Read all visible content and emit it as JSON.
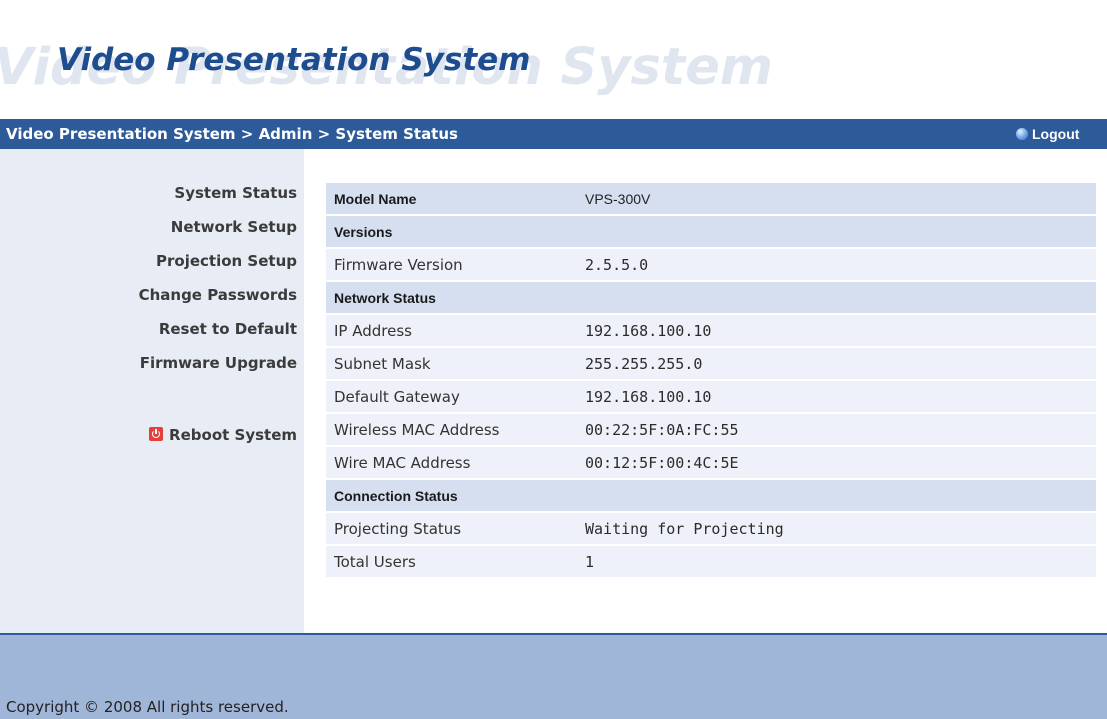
{
  "header": {
    "title": "Video Presentation System",
    "watermark": "Video Presentation System"
  },
  "navbar": {
    "breadcrumb": "Video Presentation System > Admin > System Status",
    "logout_label": "Logout"
  },
  "sidebar": {
    "items": [
      {
        "label": "System Status"
      },
      {
        "label": "Network Setup"
      },
      {
        "label": "Projection Setup"
      },
      {
        "label": "Change Passwords"
      },
      {
        "label": "Reset to Default"
      },
      {
        "label": "Firmware Upgrade"
      }
    ],
    "reboot_label": "Reboot System"
  },
  "status": {
    "rows": [
      {
        "label": "Model Name",
        "value": "VPS-300V"
      },
      {
        "label": "Versions"
      },
      {
        "label": "Firmware Version",
        "value": "2.5.5.0"
      },
      {
        "label": "Network Status"
      },
      {
        "label": "IP Address",
        "value": "192.168.100.10"
      },
      {
        "label": "Subnet Mask",
        "value": "255.255.255.0"
      },
      {
        "label": "Default Gateway",
        "value": "192.168.100.10"
      },
      {
        "label": "Wireless MAC Address",
        "value": "00:22:5F:0A:FC:55"
      },
      {
        "label": "Wire MAC Address",
        "value": "00:12:5F:00:4C:5E"
      },
      {
        "label": "Connection Status"
      },
      {
        "label": "Projecting Status",
        "value": "Waiting for Projecting"
      },
      {
        "label": "Total Users",
        "value": "1"
      }
    ]
  },
  "footer": {
    "copyright": "Copyright © 2008 All rights reserved."
  },
  "colors": {
    "navbar": "#2d5b99",
    "sidebar": "#e7ecf5",
    "section_header": "#d5dff0",
    "row": "#eef1f9",
    "footer": "#a0b6d8",
    "title": "#1d4c8f"
  }
}
